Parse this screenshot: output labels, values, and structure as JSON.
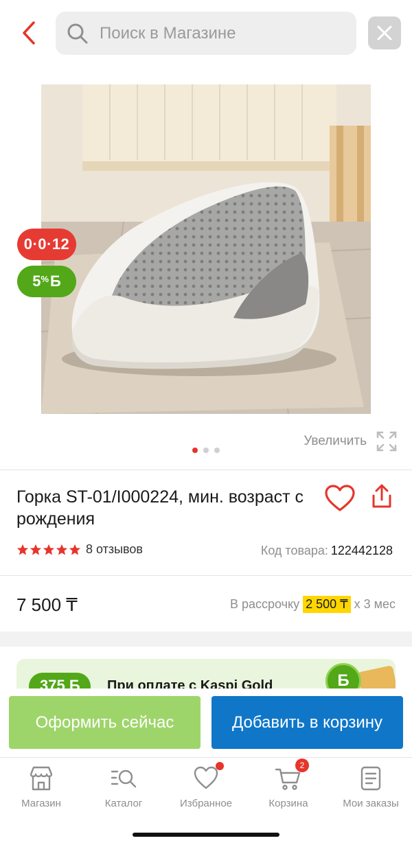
{
  "header": {
    "search_placeholder": "Поиск в Магазине",
    "icons": {
      "back": "chevron-left-icon",
      "search": "search-icon",
      "close": "close-icon"
    }
  },
  "product": {
    "badges": {
      "installment": "0·0·12",
      "bonus_value": "5",
      "bonus_percent": "%",
      "bonus_symbol": "Б"
    },
    "gallery": {
      "zoom_label": "Увеличить",
      "image_count": 3,
      "active_index": 0
    },
    "title": "Горка ST-01/I000224, мин. возраст с рождения",
    "rating": {
      "stars": 5,
      "reviews": "8 отзывов"
    },
    "sku": {
      "label": "Код товара:",
      "value": "122442128"
    },
    "price": "7 500 ₸",
    "installment": {
      "prefix": "В рассрочку",
      "amount": "2 500 ₸",
      "suffix": "х 3 мес"
    }
  },
  "promo": {
    "badge": "375 Б",
    "text": "При оплате с Kaspi Gold",
    "coin": "Б"
  },
  "actions": {
    "checkout": "Оформить сейчас",
    "add_to_cart": "Добавить в корзину"
  },
  "tabbar": {
    "items": [
      {
        "label": "Магазин",
        "icon": "store-icon"
      },
      {
        "label": "Каталог",
        "icon": "catalog-search-icon"
      },
      {
        "label": "Избранное",
        "icon": "heart-icon"
      },
      {
        "label": "Корзина",
        "icon": "cart-icon",
        "badge": "2"
      },
      {
        "label": "Мои заказы",
        "icon": "orders-icon"
      }
    ]
  },
  "colors": {
    "accent_red": "#e6352b",
    "kaspi_green": "#52a818",
    "checkout_green": "#9ed56a",
    "cart_blue": "#1077c8",
    "highlight_yellow": "#ffd600"
  }
}
